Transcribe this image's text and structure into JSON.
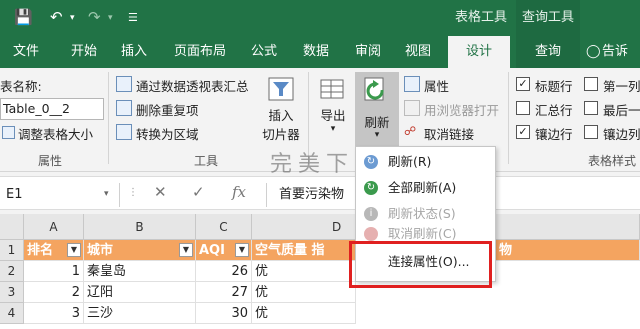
{
  "titlebar": {
    "context_table_tools": "表格工具",
    "context_query_tools": "查询工具"
  },
  "tabs": [
    {
      "label": "文件"
    },
    {
      "label": "开始"
    },
    {
      "label": "插入"
    },
    {
      "label": "页面布局"
    },
    {
      "label": "公式"
    },
    {
      "label": "数据"
    },
    {
      "label": "审阅"
    },
    {
      "label": "视图"
    },
    {
      "label": "设计"
    },
    {
      "label": "查询"
    },
    {
      "label": "告诉我"
    }
  ],
  "properties_group": {
    "name_label": "表名称:",
    "name_value": "Table_0__2",
    "resize_label": "调整表格大小",
    "group_label": "属性"
  },
  "tools_group": {
    "pivot_label": "通过数据透视表汇总",
    "remove_dup_label": "删除重复项",
    "convert_label": "转换为区域",
    "slicer_label_1": "插入",
    "slicer_label_2": "切片器",
    "group_label": "工具"
  },
  "external_group": {
    "export_label": "导出",
    "refresh_label": "刷新",
    "properties_label": "属性",
    "open_browser_label": "用浏览器打开",
    "unlink_label": "取消链接"
  },
  "style_options": {
    "header_row": "标题行",
    "total_row": "汇总行",
    "banded_rows": "镶边行",
    "first_col": "第一列",
    "last_col": "最后一",
    "banded_cols": "镶边列",
    "group_label": "表格样式"
  },
  "watermark": "完美下载",
  "formula_bar": {
    "namebox": "E1",
    "content": "首要污染物"
  },
  "grid": {
    "columns": [
      "A",
      "B",
      "C",
      "D"
    ],
    "rows": [
      "1",
      "2",
      "3",
      "4"
    ],
    "header": [
      "排名",
      "城市",
      "AQI",
      "空气质量 指",
      "物"
    ],
    "data": [
      [
        "1",
        "秦皇岛",
        "26",
        "优"
      ],
      [
        "2",
        "辽阳",
        "27",
        "优"
      ],
      [
        "3",
        "三沙",
        "30",
        "优"
      ]
    ]
  },
  "refresh_menu": {
    "items": [
      {
        "label": "刷新(R)",
        "enabled": true
      },
      {
        "label": "全部刷新(A)",
        "enabled": true
      },
      {
        "label": "刷新状态(S)",
        "enabled": false
      },
      {
        "label": "取消刷新(C)",
        "enabled": false
      },
      {
        "label": "连接属性(O)...",
        "enabled": true
      }
    ]
  },
  "colors": {
    "excel_green": "#217346",
    "table_header": "#f4a460",
    "highlight": "#e02020"
  }
}
